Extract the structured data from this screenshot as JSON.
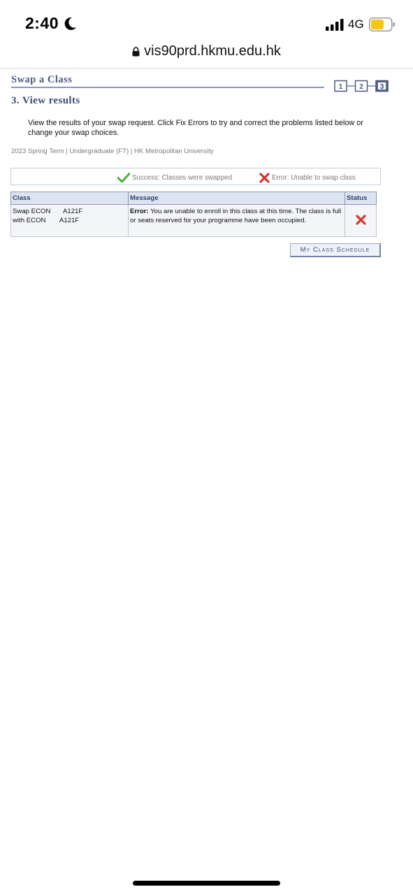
{
  "status_bar": {
    "time": "2:40",
    "network": "4G",
    "icons": [
      "moon-icon",
      "signal-icon",
      "battery-icon"
    ],
    "battery_color": "#f5c518"
  },
  "browser": {
    "url": "vis90prd.hkmu.edu.hk"
  },
  "page": {
    "title": "Swap a Class",
    "steps": [
      "1",
      "2",
      "3"
    ],
    "active_step": "3",
    "step_title": "3.  View results",
    "instructions": "View the results of your swap request.  Click Fix Errors to try and correct the problems listed below or change your swap choices.",
    "term_line": "2023 Spring Term | Undergraduate (FT) | HK Metropolitan University"
  },
  "legend": {
    "success": "Success: Classes were swapped",
    "error": "Error: Unable to swap class"
  },
  "results_table": {
    "headers": [
      "Class",
      "Message",
      "Status"
    ],
    "rows": [
      {
        "class_line1_a": "Swap ECON",
        "class_line1_b": "A121F",
        "class_line2_a": "with ECON",
        "class_line2_b": "A121F",
        "message_label": "Error:",
        "message_text": " You are unable to enroll in this class at this time. The class is full or seats reserved for your programme have been occupied.",
        "status": "error"
      }
    ]
  },
  "buttons": {
    "my_class_schedule": "My Class Schedule"
  },
  "colors": {
    "title_blue": "#4a5a82",
    "header_bg": "#dde4f1",
    "success_green": "#4caf3a",
    "error_red": "#d9342b"
  }
}
